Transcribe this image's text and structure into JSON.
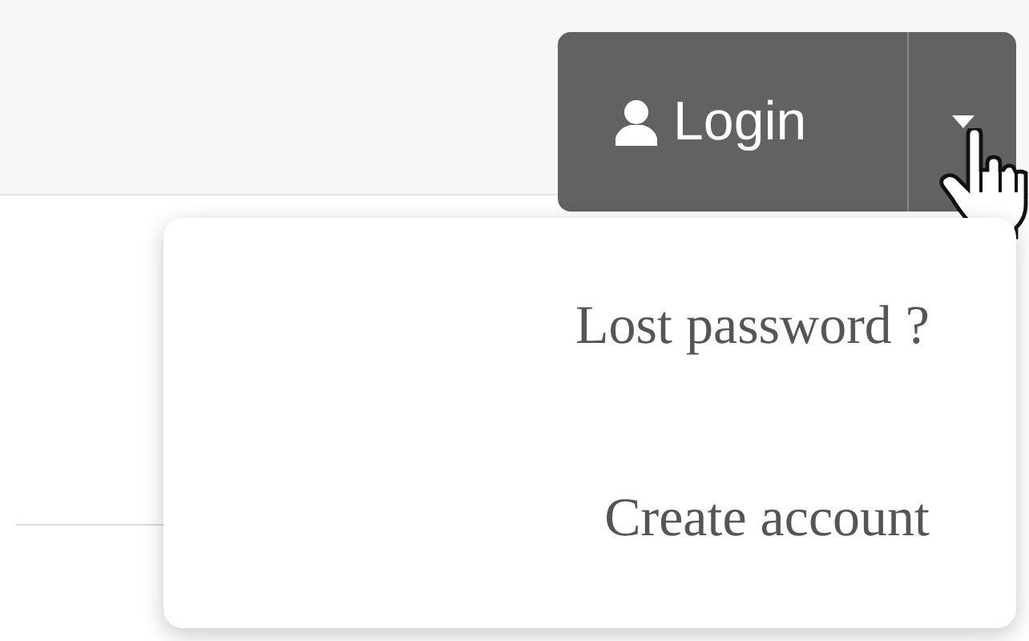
{
  "login_button": {
    "label": "Login"
  },
  "dropdown": {
    "expanded": true,
    "items": [
      {
        "label": "Lost password ?"
      },
      {
        "label": "Create account"
      }
    ]
  }
}
